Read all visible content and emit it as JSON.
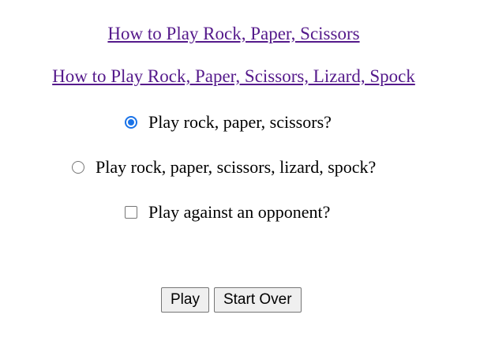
{
  "links": {
    "rps": "How to Play Rock, Paper, Scissors",
    "rpsls": "How to Play Rock, Paper, Scissors, Lizard, Spock"
  },
  "options": {
    "rps": {
      "label": "Play rock, paper, scissors?",
      "checked": true
    },
    "rpsls": {
      "label": "Play rock, paper, scissors, lizard, spock?",
      "checked": false
    },
    "opponent": {
      "label": "Play against an opponent?",
      "checked": false
    }
  },
  "buttons": {
    "play": "Play",
    "start_over": "Start Over"
  },
  "colors": {
    "link": "#551a8b",
    "accent": "#1a73e8",
    "button_bg": "#efefef"
  }
}
